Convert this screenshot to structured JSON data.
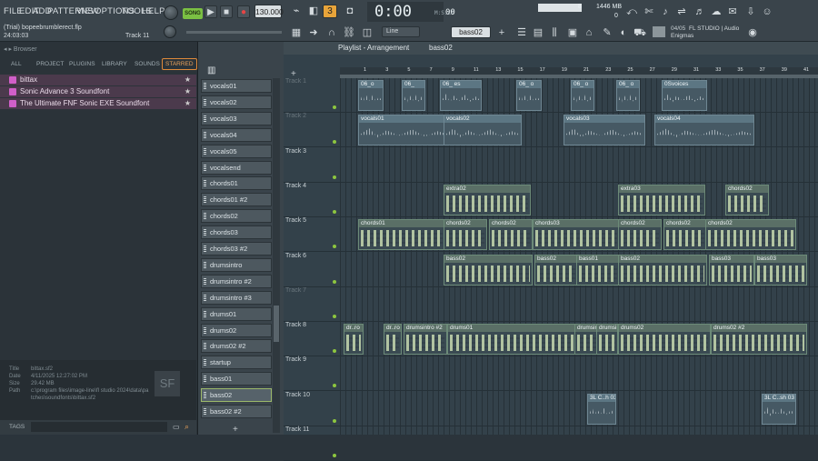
{
  "menu": [
    "FILE",
    "EDIT",
    "ADD",
    "PATTERNS",
    "VIEW",
    "OPTIONS",
    "TOOLS",
    "HELP"
  ],
  "transport": {
    "mode": "SONG",
    "tempo": "130.000",
    "time": "0:00",
    "time_frac": "00",
    "time_label": "M:S:CS"
  },
  "pattern_num": "3",
  "hint": {
    "file": "(Trial) bopeebrumblerect.flp",
    "time": "24:03:03",
    "track": "Track 11"
  },
  "cpu": {
    "num": "8",
    "mem": "1446 MB",
    "mem2": "0"
  },
  "news": {
    "date": "04/05",
    "text": "FL STUDIO | Audio",
    "author": "Enigmas"
  },
  "snap": "Line",
  "current_pattern": "bass02",
  "browser": {
    "title": "Browser",
    "tabs": [
      "ALL",
      "PROJECT",
      "PLUGINS",
      "LIBRARY",
      "SOUNDS",
      "STARRED"
    ],
    "items": [
      "bittax",
      "Sonic Advance 3 Soundfont",
      "The Ultimate FNF Sonic EXE Soundfont"
    ],
    "info": {
      "labels": [
        "Title",
        "Date",
        "Size",
        "Path"
      ],
      "values": [
        "bittax.sf2",
        "4/11/2025 12:27:02 PM",
        "29.42 MB",
        "c:\\program files\\image-line\\fl studio 2024\\data\\patches\\soundfonts\\bittax.sf2"
      ]
    },
    "tags_label": "TAGS"
  },
  "channels": [
    "vocals01",
    "vocals02",
    "vocals03",
    "vocals04",
    "vocals05",
    "vocalsend",
    "chords01",
    "chords01 #2",
    "chords02",
    "chords03",
    "chords03 #2",
    "drumsintro",
    "drumsintro #2",
    "drumsintro #3",
    "drums01",
    "drums02",
    "drums02 #2",
    "startup",
    "bass01",
    "bass02",
    "bass02 #2"
  ],
  "playlist": {
    "title": "Playlist - Arrangement",
    "crumb": "bass02",
    "ruler": [
      "1",
      "3",
      "5",
      "7",
      "9",
      "11",
      "13",
      "15",
      "17",
      "19",
      "21",
      "23",
      "25",
      "27",
      "29",
      "31",
      "33",
      "35",
      "37",
      "39",
      "41"
    ],
    "tracks": [
      "Track 1",
      "Track 2",
      "Track 3",
      "Track 4",
      "Track 5",
      "Track 6",
      "Track 7",
      "Track 8",
      "Track 9",
      "Track 10",
      "Track 11"
    ],
    "clips": {
      "t1": [
        "06_o",
        "06_ ",
        "06_ es",
        "06_ o",
        "06_ o",
        "06_ o",
        "0Svoices"
      ],
      "t2": [
        "vocals01",
        "vocals02",
        "vocals03",
        "vocals04"
      ],
      "t4": [
        "extra02",
        "extra03",
        "chords02"
      ],
      "t5": [
        "chords01",
        "chords02",
        "chords02",
        "chords03",
        "chords02",
        "chords02",
        "chords02"
      ],
      "t6": [
        "bass02",
        "bass02",
        "bass01",
        "bass02",
        "bass03",
        "bass03"
      ],
      "t8": [
        "dr..ro",
        "dr..ro",
        "drumsintro #2",
        "drums01",
        "drumsintro #3",
        "drumsintro #3",
        "drums02",
        "drums02 #2"
      ],
      "t10": [
        "3L C..h 03",
        "3L C..sh 03"
      ]
    }
  }
}
